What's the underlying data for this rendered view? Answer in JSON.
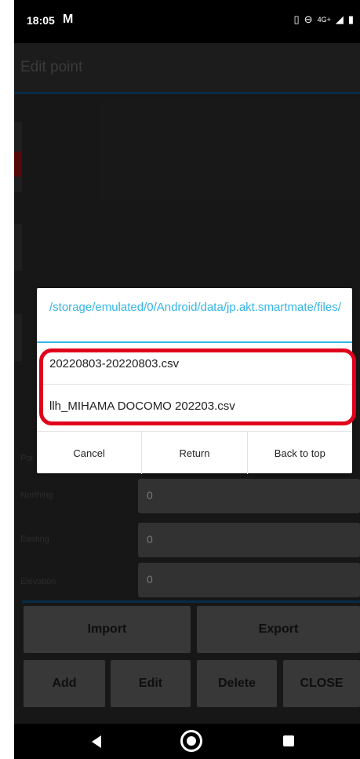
{
  "status_bar": {
    "time": "18:05",
    "carrier_icon": "M",
    "network_label": "4G+"
  },
  "app_bar": {
    "title": "Edit point"
  },
  "fields": [
    {
      "label": "Northing",
      "value": "0"
    },
    {
      "label": "Easting",
      "value": "0"
    },
    {
      "label": "Elevation",
      "value": "0"
    }
  ],
  "partial_label": "Poi",
  "buttons": {
    "import": "Import",
    "export": "Export",
    "add": "Add",
    "edit": "Edit",
    "delete": "Delete",
    "close": "CLOSE"
  },
  "dialog": {
    "path": "/storage/emulated/0/Android/data/jp.akt.smartmate/files/",
    "files": [
      "20220803-20220803.csv",
      "llh_MIHAMA DOCOMO 202203.csv"
    ],
    "cancel": "Cancel",
    "return": "Return",
    "back_to_top": "Back to top"
  },
  "colors": {
    "accent": "#33b5e5",
    "highlight": "#e0001b",
    "appbar_line": "#0f4f80"
  },
  "icons": [
    "vibrate-icon",
    "dnd-icon",
    "signal-icon",
    "battery-icon",
    "back-icon",
    "home-icon",
    "recents-icon"
  ]
}
